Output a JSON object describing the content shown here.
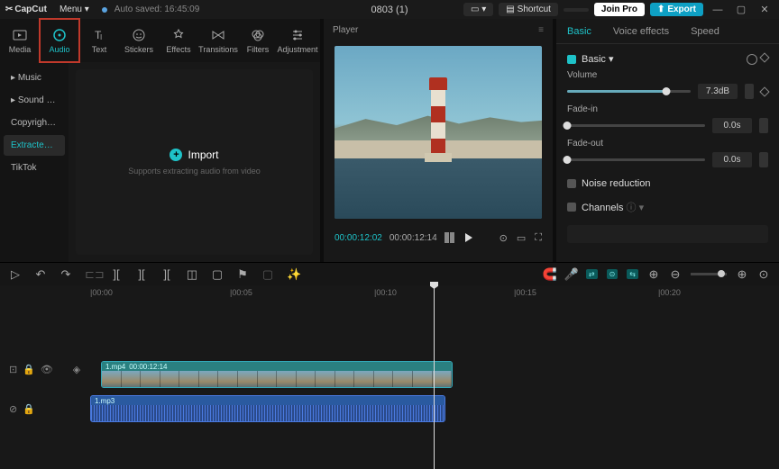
{
  "titlebar": {
    "app": "CapCut",
    "menu": "Menu",
    "autosave": "Auto saved: 16:45:09",
    "project": "0803 (1)",
    "shortcut": "Shortcut",
    "join": "Join Pro",
    "export": "Export"
  },
  "tabs": {
    "media": "Media",
    "audio": "Audio",
    "text": "Text",
    "stickers": "Stickers",
    "effects": "Effects",
    "transitions": "Transitions",
    "filters": "Filters",
    "adjustment": "Adjustment"
  },
  "sidebar": {
    "items": [
      "Music",
      "Sound eff...",
      "Copyright c...",
      "Extracted a...",
      "TikTok"
    ],
    "selected": 3
  },
  "import": {
    "label": "Import",
    "sub": "Supports extracting audio from video"
  },
  "player": {
    "title": "Player",
    "tc_current": "00:00:12:02",
    "tc_total": "00:00:12:14"
  },
  "inspector": {
    "tabs": {
      "basic": "Basic",
      "voice": "Voice effects",
      "speed": "Speed"
    },
    "basic_section": "Basic",
    "volume": {
      "label": "Volume",
      "value": "7.3dB",
      "pct": 80
    },
    "fadein": {
      "label": "Fade-in",
      "value": "0.0s",
      "pct": 0
    },
    "fadeout": {
      "label": "Fade-out",
      "value": "0.0s",
      "pct": 0
    },
    "noise": "Noise reduction",
    "channels": "Channels"
  },
  "ruler": {
    "ticks": [
      "|00:00",
      "|00:05",
      "|00:10",
      "|00:15",
      "|00:20"
    ]
  },
  "clips": {
    "video": {
      "name": "1.mp4",
      "dur": "00:00:12:14"
    },
    "audio": {
      "name": "1.mp3"
    }
  }
}
